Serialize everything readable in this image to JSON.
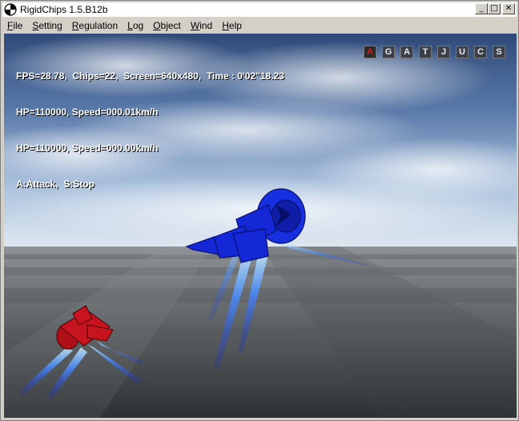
{
  "window": {
    "title": "RigidChips 1.5.B12b"
  },
  "title_buttons": {
    "minimize": "_",
    "maximize": "□",
    "close": "✕"
  },
  "menu": [
    {
      "label": "File",
      "accel": "F",
      "rest": "ile"
    },
    {
      "label": "Setting",
      "accel": "S",
      "rest": "etting"
    },
    {
      "label": "Regulation",
      "accel": "R",
      "rest": "egulation"
    },
    {
      "label": "Log",
      "accel": "L",
      "rest": "og"
    },
    {
      "label": "Object",
      "accel": "O",
      "rest": "bject"
    },
    {
      "label": "Wind",
      "accel": "W",
      "rest": "ind"
    },
    {
      "label": "Help",
      "accel": "H",
      "rest": "elp"
    }
  ],
  "hud": {
    "line1": "FPS=28.78,  Chips=22,  Screen=640x480,  Time : 0'02\"18.23",
    "line2": "HP=110000, Speed=000.01km/h",
    "line3": "HP=110000, Speed=000.00km/h",
    "line4": "A:Attack,  S:Stop"
  },
  "modes": [
    "A",
    "G",
    "A",
    "T",
    "J",
    "U",
    "C",
    "S"
  ],
  "active_mode_index": 0,
  "colors": {
    "sky_top": "#3a5a8a",
    "ground": "#6b6e70",
    "player_chip": "#1428d8",
    "enemy_chip": "#c8141e",
    "jet_flame": "#5090ff"
  }
}
